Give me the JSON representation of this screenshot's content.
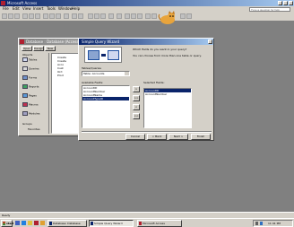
{
  "app": {
    "title": "Microsoft Access",
    "menu": [
      "File",
      "Edit",
      "View",
      "Insert",
      "Tools",
      "Window",
      "Help"
    ],
    "help_placeholder": "Type a question for help"
  },
  "db_window": {
    "title": "Database : Database (Access 2000 file format)",
    "toolbar": [
      "Open",
      "Design",
      "New"
    ],
    "objects_label": "Objects",
    "nav": [
      "Tables",
      "Queries",
      "Forms",
      "Reports",
      "Pages",
      "Macros",
      "Modules"
    ],
    "groups_label": "Groups",
    "favorites_label": "Favorites",
    "list_items": [
      "Create",
      "Create",
      "Acco",
      "Cust",
      "Ord",
      "Prod"
    ]
  },
  "wizard": {
    "title": "Simple Query Wizard",
    "question": "Which fields do you want in your query?",
    "hint": "You can choose from more than one table or query.",
    "tables_label": "Tables/Queries",
    "tables_value": "Table: Accounts",
    "available_label": "Available Fields:",
    "available_fields": [
      "AccountID",
      "AccountNumber",
      "AccountName",
      "AccountTypeID"
    ],
    "selected_available_index": 3,
    "selected_label": "Selected Fields:",
    "selected_fields": [
      "AccountID",
      "AccountNumber"
    ],
    "selected_selected_index": 0,
    "move_buttons": [
      ">",
      ">>",
      "<",
      "<<"
    ],
    "buttons": [
      "Cancel",
      "< Back",
      "Next >",
      "Finish"
    ]
  },
  "status": {
    "text": "Ready"
  },
  "taskbar": {
    "start_label": "start",
    "tasks": [
      "Database: Database",
      "Simple Query Wizard"
    ],
    "tray_time": "11:41 PM"
  },
  "colors": {
    "desktop": "#808080",
    "title_active": "#0a246a",
    "title_inactive": "#808080",
    "face": "#d4d0c8",
    "taskbar": "#d4d0c8"
  }
}
